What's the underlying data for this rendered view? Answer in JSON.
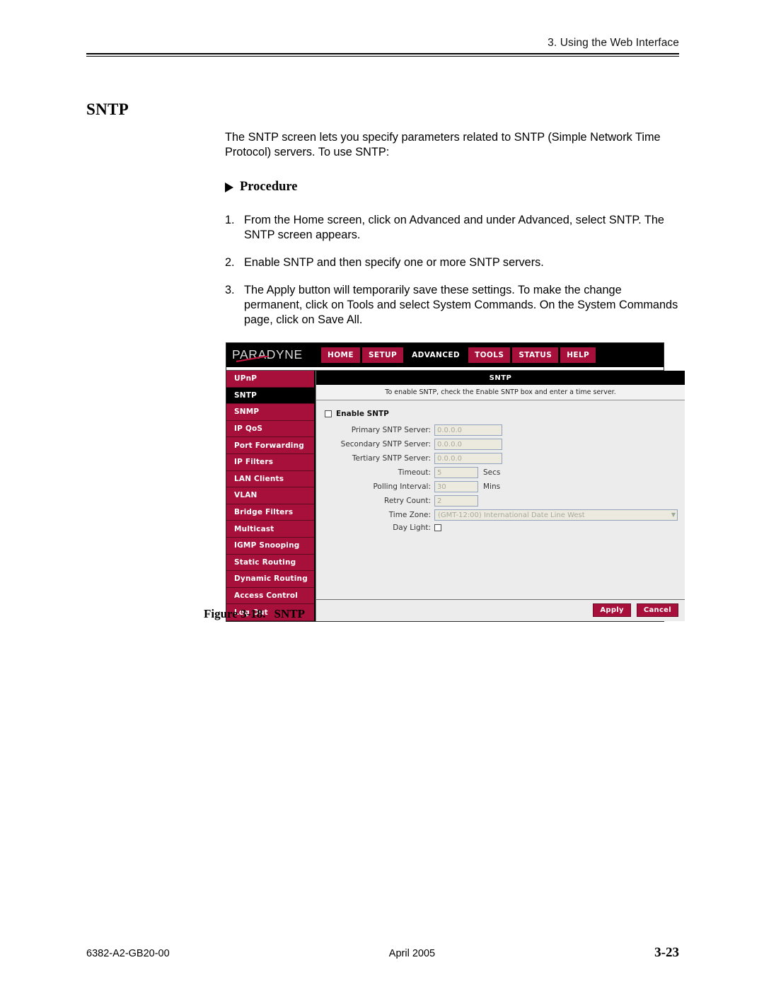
{
  "header": {
    "chapter_text": "3. Using the Web Interface"
  },
  "section": {
    "title": "SNTP",
    "intro": "The SNTP screen lets you specify parameters related to SNTP (Simple Network Time Protocol) servers. To use SNTP:",
    "procedure_label": "Procedure",
    "steps": [
      {
        "num": "1.",
        "text": "From the Home screen, click on Advanced and under Advanced, select SNTP. The SNTP screen appears."
      },
      {
        "num": "2.",
        "text": "Enable SNTP and then specify one or more SNTP servers."
      },
      {
        "num": "3.",
        "text": "The Apply button will temporarily save these settings. To make the change permanent, click on Tools and select System Commands. On the System Commands page, click on Save All."
      }
    ]
  },
  "figure": {
    "caption_number": "Figure 3-18.",
    "caption_title": "SNTP"
  },
  "router_ui": {
    "brand": "PARADYNE",
    "nav": [
      {
        "label": "HOME",
        "active": false
      },
      {
        "label": "SETUP",
        "active": false
      },
      {
        "label": "ADVANCED",
        "active": true
      },
      {
        "label": "TOOLS",
        "active": false
      },
      {
        "label": "STATUS",
        "active": false
      },
      {
        "label": "HELP",
        "active": false
      }
    ],
    "sidebar": [
      {
        "label": "UPnP",
        "active": false
      },
      {
        "label": "SNTP",
        "active": true
      },
      {
        "label": "SNMP",
        "active": false
      },
      {
        "label": "IP QoS",
        "active": false
      },
      {
        "label": "Port Forwarding",
        "active": false
      },
      {
        "label": "IP Filters",
        "active": false
      },
      {
        "label": "LAN Clients",
        "active": false
      },
      {
        "label": "VLAN",
        "active": false
      },
      {
        "label": "Bridge Filters",
        "active": false
      },
      {
        "label": "Multicast",
        "active": false
      },
      {
        "label": "IGMP Snooping",
        "active": false
      },
      {
        "label": "Static Routing",
        "active": false
      },
      {
        "label": "Dynamic Routing",
        "active": false
      },
      {
        "label": "Access Control",
        "active": false
      },
      {
        "label": "Log Out",
        "active": false
      }
    ],
    "panel": {
      "title": "SNTP",
      "hint": "To enable SNTP, check the Enable SNTP box and enter a time server.",
      "enable_label": "Enable SNTP",
      "fields": {
        "primary_label": "Primary SNTP Server:",
        "primary_value": "0.0.0.0",
        "secondary_label": "Secondary SNTP Server:",
        "secondary_value": "0.0.0.0",
        "tertiary_label": "Tertiary SNTP Server:",
        "tertiary_value": "0.0.0.0",
        "timeout_label": "Timeout:",
        "timeout_value": "5",
        "timeout_unit": "Secs",
        "polling_label": "Polling Interval:",
        "polling_value": "30",
        "polling_unit": "Mins",
        "retry_label": "Retry Count:",
        "retry_value": "2",
        "timezone_label": "Time Zone:",
        "timezone_value": "(GMT-12:00) International Date Line West",
        "daylight_label": "Day Light:"
      },
      "buttons": {
        "apply": "Apply",
        "cancel": "Cancel"
      }
    },
    "colors": {
      "crimson": "#a8103c",
      "black": "#000000",
      "field_fill": "#eceade",
      "panel_bg": "#ececec"
    }
  },
  "footer": {
    "doc_number": "6382-A2-GB20-00",
    "date": "April 2005",
    "page": "3-23"
  }
}
